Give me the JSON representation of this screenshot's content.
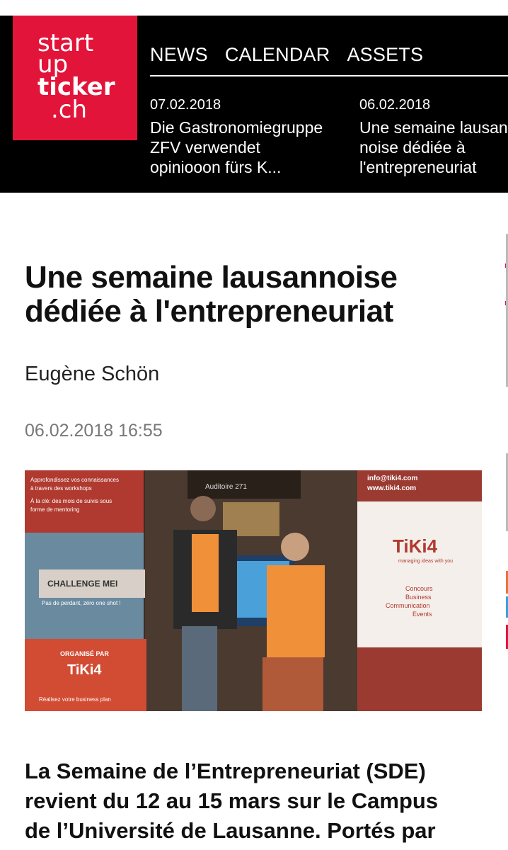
{
  "logo": {
    "line1": "start",
    "line2": "up",
    "line3": "ticker",
    "line4": ".ch",
    "background": "#e3143a"
  },
  "nav": {
    "items": [
      "NEWS",
      "CALENDAR",
      "ASSETS"
    ]
  },
  "ticker": [
    {
      "date": "07.02.2018",
      "headline": "Die Gas­tronomiegruppe ZFV verwendet opiniooon fürs K..."
    },
    {
      "date": "06.02.2018",
      "headline": "Une semaine lausan­noise dédiée à l'entrepreneuriat"
    }
  ],
  "article": {
    "title": "Une semaine lausannoise dédiée à l'entrepreneuriat",
    "author": "Eugène Schön",
    "datetime": "06.02.2018 16:55",
    "lead": "La Semaine de l’Entrepreneuriat (SDE) revient du 12 au 15 mars sur le Campus de l’Université de Lausanne. Portés par"
  },
  "photo": {
    "banner_left_text1": "Approfondissez vos connaissances à travers des workshops",
    "banner_left_text2": "À la clé: des mois de suivis sous forme de mentoring",
    "challenge": "CHALLENGE MEI",
    "challenge_sub": "Pas de perdant, zéro one shot !",
    "organise": "ORGANISÉ PAR",
    "tiki": "TiKi4",
    "business_plan": "Réalisez votre business plan",
    "email": "info@tiki4.com",
    "web": "www.tiki4.com",
    "tagline": "managing ideas with you",
    "services": [
      "Concours",
      "Business",
      "Communication",
      "Events"
    ],
    "auditoire": "Auditoire 271"
  },
  "colors": {
    "header_bg": "#000000",
    "accent": "#e3143a",
    "date_gray": "#777777"
  }
}
